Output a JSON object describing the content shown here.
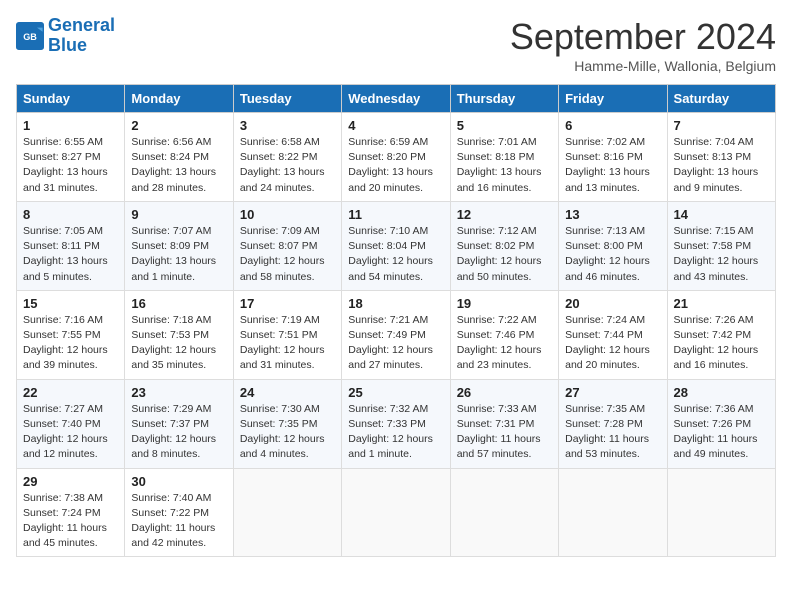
{
  "header": {
    "logo_line1": "General",
    "logo_line2": "Blue",
    "month_title": "September 2024",
    "subtitle": "Hamme-Mille, Wallonia, Belgium"
  },
  "weekdays": [
    "Sunday",
    "Monday",
    "Tuesday",
    "Wednesday",
    "Thursday",
    "Friday",
    "Saturday"
  ],
  "weeks": [
    [
      {
        "day": "1",
        "sunrise": "6:55 AM",
        "sunset": "8:27 PM",
        "daylight": "13 hours and 31 minutes."
      },
      {
        "day": "2",
        "sunrise": "6:56 AM",
        "sunset": "8:24 PM",
        "daylight": "13 hours and 28 minutes."
      },
      {
        "day": "3",
        "sunrise": "6:58 AM",
        "sunset": "8:22 PM",
        "daylight": "13 hours and 24 minutes."
      },
      {
        "day": "4",
        "sunrise": "6:59 AM",
        "sunset": "8:20 PM",
        "daylight": "13 hours and 20 minutes."
      },
      {
        "day": "5",
        "sunrise": "7:01 AM",
        "sunset": "8:18 PM",
        "daylight": "13 hours and 16 minutes."
      },
      {
        "day": "6",
        "sunrise": "7:02 AM",
        "sunset": "8:16 PM",
        "daylight": "13 hours and 13 minutes."
      },
      {
        "day": "7",
        "sunrise": "7:04 AM",
        "sunset": "8:13 PM",
        "daylight": "13 hours and 9 minutes."
      }
    ],
    [
      {
        "day": "8",
        "sunrise": "7:05 AM",
        "sunset": "8:11 PM",
        "daylight": "13 hours and 5 minutes."
      },
      {
        "day": "9",
        "sunrise": "7:07 AM",
        "sunset": "8:09 PM",
        "daylight": "13 hours and 1 minute."
      },
      {
        "day": "10",
        "sunrise": "7:09 AM",
        "sunset": "8:07 PM",
        "daylight": "12 hours and 58 minutes."
      },
      {
        "day": "11",
        "sunrise": "7:10 AM",
        "sunset": "8:04 PM",
        "daylight": "12 hours and 54 minutes."
      },
      {
        "day": "12",
        "sunrise": "7:12 AM",
        "sunset": "8:02 PM",
        "daylight": "12 hours and 50 minutes."
      },
      {
        "day": "13",
        "sunrise": "7:13 AM",
        "sunset": "8:00 PM",
        "daylight": "12 hours and 46 minutes."
      },
      {
        "day": "14",
        "sunrise": "7:15 AM",
        "sunset": "7:58 PM",
        "daylight": "12 hours and 43 minutes."
      }
    ],
    [
      {
        "day": "15",
        "sunrise": "7:16 AM",
        "sunset": "7:55 PM",
        "daylight": "12 hours and 39 minutes."
      },
      {
        "day": "16",
        "sunrise": "7:18 AM",
        "sunset": "7:53 PM",
        "daylight": "12 hours and 35 minutes."
      },
      {
        "day": "17",
        "sunrise": "7:19 AM",
        "sunset": "7:51 PM",
        "daylight": "12 hours and 31 minutes."
      },
      {
        "day": "18",
        "sunrise": "7:21 AM",
        "sunset": "7:49 PM",
        "daylight": "12 hours and 27 minutes."
      },
      {
        "day": "19",
        "sunrise": "7:22 AM",
        "sunset": "7:46 PM",
        "daylight": "12 hours and 23 minutes."
      },
      {
        "day": "20",
        "sunrise": "7:24 AM",
        "sunset": "7:44 PM",
        "daylight": "12 hours and 20 minutes."
      },
      {
        "day": "21",
        "sunrise": "7:26 AM",
        "sunset": "7:42 PM",
        "daylight": "12 hours and 16 minutes."
      }
    ],
    [
      {
        "day": "22",
        "sunrise": "7:27 AM",
        "sunset": "7:40 PM",
        "daylight": "12 hours and 12 minutes."
      },
      {
        "day": "23",
        "sunrise": "7:29 AM",
        "sunset": "7:37 PM",
        "daylight": "12 hours and 8 minutes."
      },
      {
        "day": "24",
        "sunrise": "7:30 AM",
        "sunset": "7:35 PM",
        "daylight": "12 hours and 4 minutes."
      },
      {
        "day": "25",
        "sunrise": "7:32 AM",
        "sunset": "7:33 PM",
        "daylight": "12 hours and 1 minute."
      },
      {
        "day": "26",
        "sunrise": "7:33 AM",
        "sunset": "7:31 PM",
        "daylight": "11 hours and 57 minutes."
      },
      {
        "day": "27",
        "sunrise": "7:35 AM",
        "sunset": "7:28 PM",
        "daylight": "11 hours and 53 minutes."
      },
      {
        "day": "28",
        "sunrise": "7:36 AM",
        "sunset": "7:26 PM",
        "daylight": "11 hours and 49 minutes."
      }
    ],
    [
      {
        "day": "29",
        "sunrise": "7:38 AM",
        "sunset": "7:24 PM",
        "daylight": "11 hours and 45 minutes."
      },
      {
        "day": "30",
        "sunrise": "7:40 AM",
        "sunset": "7:22 PM",
        "daylight": "11 hours and 42 minutes."
      },
      null,
      null,
      null,
      null,
      null
    ]
  ]
}
